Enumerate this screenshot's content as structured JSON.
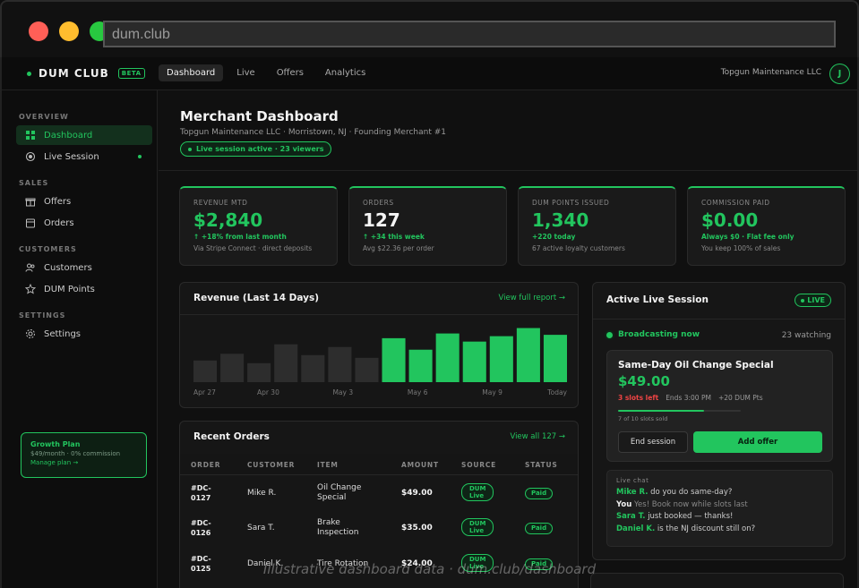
{
  "browser": {
    "url": "dum.club"
  },
  "topnav": {
    "brand": "DUM CLUB",
    "beta": "BETA",
    "tabs": [
      "Dashboard",
      "Live",
      "Offers",
      "Analytics"
    ],
    "merchant": "Topgun Maintenance LLC",
    "avatar_initial": "J"
  },
  "sidebar": {
    "sections": [
      "OVERVIEW",
      "SALES",
      "CUSTOMERS",
      "SETTINGS"
    ],
    "items": [
      "Dashboard",
      "Live Session",
      "Offers",
      "Orders",
      "Customers",
      "DUM Points",
      "Settings"
    ],
    "plan": {
      "title": "Growth Plan",
      "sub": "$49/month · 0% commission",
      "link": "Manage plan →"
    }
  },
  "header": {
    "title": "Merchant Dashboard",
    "subtitle": "Topgun Maintenance LLC · Morristown, NJ · Founding Merchant #1",
    "session_pill": "Live session active · 23 viewers"
  },
  "stats": [
    {
      "label": "REVENUE MTD",
      "value": "$2,840",
      "delta": "↑ +18% from last month",
      "note": "Via Stripe Connect · direct deposits",
      "accent": "green"
    },
    {
      "label": "ORDERS",
      "value": "127",
      "delta": "↑ +34 this week",
      "note": "Avg $22.36 per order",
      "accent": "white"
    },
    {
      "label": "DUM POINTS ISSUED",
      "value": "1,340",
      "delta": "+220 today",
      "note": "67 active loyalty customers",
      "accent": "green"
    },
    {
      "label": "COMMISSION PAID",
      "value": "$0.00",
      "delta": "Always $0 · Flat fee only",
      "note": "You keep 100% of sales",
      "accent": "green"
    }
  ],
  "revenue": {
    "title": "Revenue (Last 14 Days)",
    "link": "View full report →"
  },
  "chart_data": {
    "type": "bar",
    "title": "Revenue (Last 14 Days)",
    "categories": [
      "Apr 27",
      "",
      "",
      "Apr 30",
      "",
      "",
      "May 3",
      "",
      "",
      "May 6",
      "",
      "",
      "May 9",
      "",
      "Today"
    ],
    "tick_labels": [
      "Apr 27",
      "Apr 30",
      "May 3",
      "May 6",
      "May 9",
      "Today"
    ],
    "values": [
      32,
      42,
      28,
      56,
      40,
      52,
      36,
      65,
      48,
      72,
      60,
      68,
      80,
      70
    ],
    "highlight_from_index": 7,
    "colors": {
      "past": "#2d2d2d",
      "recent": "#22c55e"
    },
    "ylim": [
      0,
      90
    ],
    "grid": false
  },
  "orders": {
    "title": "Recent Orders",
    "link": "View all 127 →",
    "columns": [
      "ORDER",
      "CUSTOMER",
      "ITEM",
      "AMOUNT",
      "SOURCE",
      "STATUS"
    ],
    "rows": [
      {
        "id_line1": "#DC-",
        "id_line2": "0127",
        "customer": "Mike R.",
        "item_line1": "Oil Change",
        "item_line2": "Special",
        "amount": "$49.00",
        "source_line1": "DUM",
        "source_line2": "Live",
        "status": "Paid"
      },
      {
        "id_line1": "#DC-",
        "id_line2": "0126",
        "customer": "Sara T.",
        "item_line1": "Brake",
        "item_line2": "Inspection",
        "amount": "$35.00",
        "source_line1": "DUM",
        "source_line2": "Live",
        "status": "Paid"
      },
      {
        "id_line1": "#DC-",
        "id_line2": "0125",
        "customer": "Daniel K.",
        "item_line1": "Tire Rotation",
        "item_line2": "",
        "amount": "$24.00",
        "source_line1": "DUM",
        "source_line2": "Live",
        "status": "Paid"
      }
    ]
  },
  "live": {
    "title": "Active Live Session",
    "badge": "LIVE",
    "broadcast": "Broadcasting now",
    "watching": "23 watching",
    "offer": {
      "title": "Same-Day Oil Change Special",
      "price": "$49.00",
      "slots": "3 slots left",
      "ends": "Ends 3:00 PM",
      "points": "+20 DUM Pts",
      "sold_label": "7 of 10 slots sold",
      "sold_fraction": 0.7,
      "end_button": "End session",
      "add_button": "Add offer"
    },
    "chat": {
      "label": "Live chat",
      "messages": [
        {
          "name": "Mike R.",
          "text": "do you do same-day?"
        },
        {
          "name": "You",
          "text": "Yes! Book now while slots last"
        },
        {
          "name": "Sara T.",
          "text": "just booked — thanks!"
        },
        {
          "name": "Daniel K.",
          "text": "is the NJ discount still on?"
        }
      ]
    }
  },
  "watermark": "Illustrative dashboard data · dum.club/dashboard"
}
